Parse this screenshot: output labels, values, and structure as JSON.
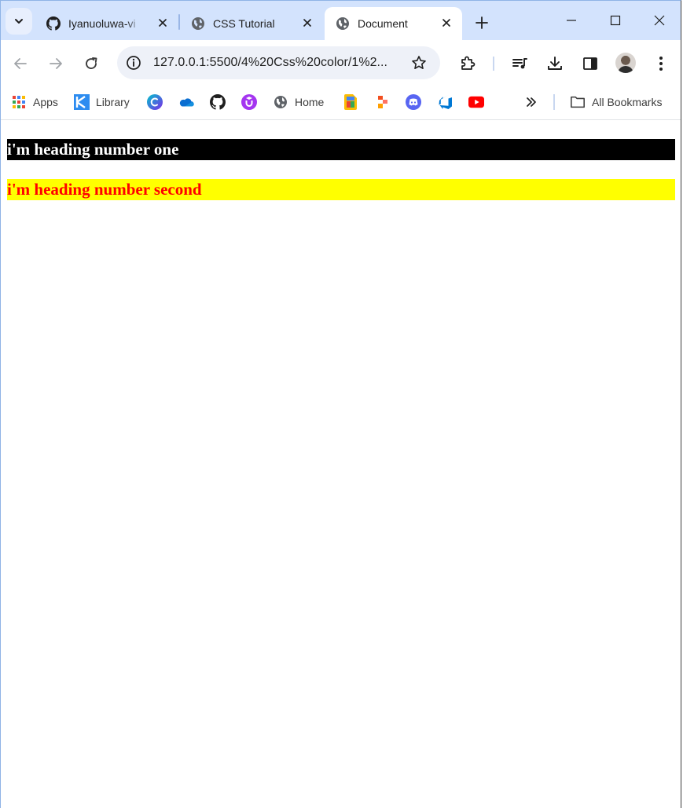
{
  "tabs": [
    {
      "title": "Iyanuoluwa-vi",
      "icon": "github-icon"
    },
    {
      "title": "CSS Tutorial",
      "icon": "globe-icon"
    },
    {
      "title": "Document",
      "icon": "globe-icon",
      "active": true
    }
  ],
  "address_bar": {
    "url": "127.0.0.1:5500/4%20Css%20color/1%2..."
  },
  "bookmarks": {
    "apps_label": "Apps",
    "library_label": "Library",
    "home_label": "Home",
    "all_bookmarks_label": "All Bookmarks",
    "icon_only": [
      "canva-icon",
      "onedrive-icon",
      "github-icon",
      "udemy-icon",
      "google-keep-icon",
      "figma-icon",
      "discord-icon",
      "azure-devops-icon",
      "youtube-icon"
    ]
  },
  "page": {
    "heading_one": "i'm heading number one",
    "heading_two": "i'm heading number second"
  },
  "colors": {
    "tabstrip": "#d3e3fd",
    "heading_one_bg": "#000000",
    "heading_one_text": "#ffffff",
    "heading_two_bg": "#ffff00",
    "heading_two_text": "#ff0000"
  }
}
